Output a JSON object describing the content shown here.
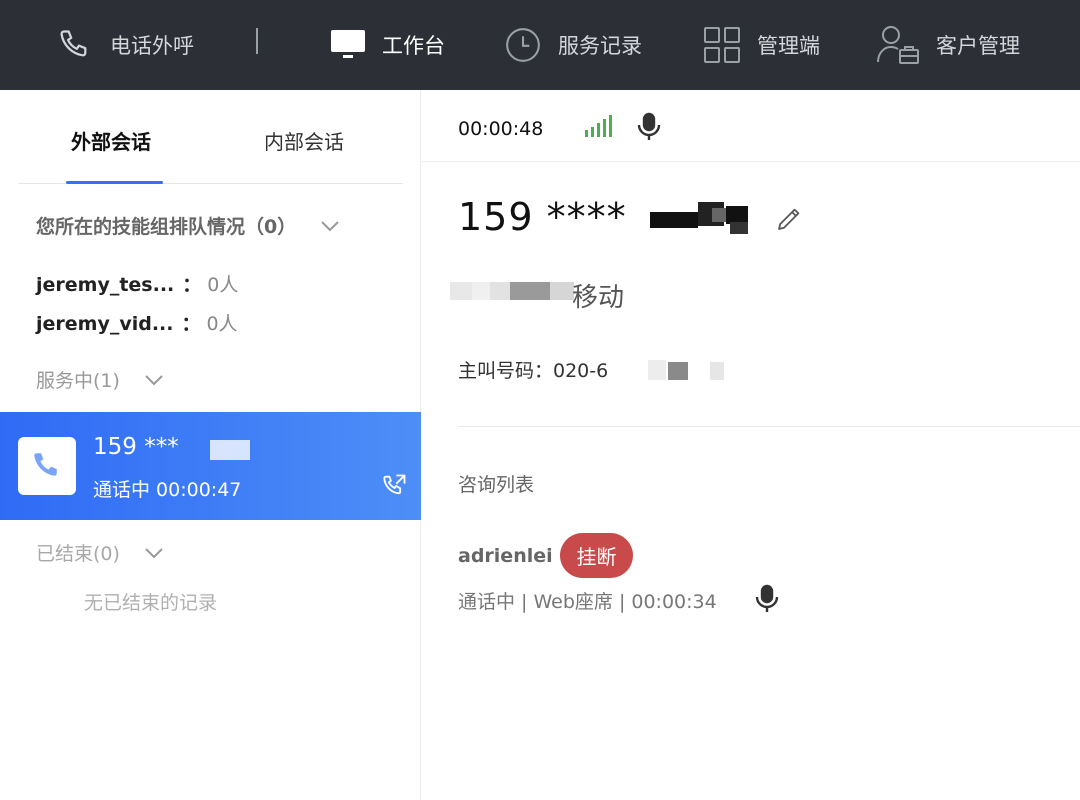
{
  "topnav": {
    "items": [
      {
        "label": "电话外呼",
        "icon": "phone-icon"
      },
      {
        "label": "工作台",
        "icon": "monitor-icon",
        "active": true
      },
      {
        "label": "服务记录",
        "icon": "clock-icon"
      },
      {
        "label": "管理端",
        "icon": "grid-icon"
      },
      {
        "label": "客户管理",
        "icon": "user-briefcase-icon"
      }
    ]
  },
  "left": {
    "tabs": [
      {
        "label": "外部会话",
        "active": true
      },
      {
        "label": "内部会话"
      }
    ],
    "queue": {
      "title": "您所在的技能组排队情况（0）",
      "rows": [
        {
          "name": "jeremy_tes...",
          "colon": "：",
          "count": "0人"
        },
        {
          "name": "jeremy_vid...",
          "colon": "：",
          "count": "0人"
        }
      ]
    },
    "serving": {
      "title": "服务中(1)",
      "card": {
        "number": "159 ***",
        "status": "通话中 00:00:47"
      }
    },
    "ended": {
      "title": "已结束(0)",
      "empty": "无已结束的记录"
    }
  },
  "right": {
    "timer": "00:00:48",
    "caller_number": "159 ****",
    "location": "移动",
    "main_number": "主叫号码：020-6",
    "consult_title": "咨询列表",
    "consult": {
      "name": "adrienlei",
      "hangup_label": "挂断",
      "meta": "通话中 | Web座席 | 00:00:34"
    }
  },
  "colors": {
    "nav_bg": "#2c2f36",
    "accent": "#3370ff",
    "card_gradient_start": "#2f6bf5",
    "card_gradient_end": "#4d8ef7",
    "signal": "#4caf50",
    "hangup": "#c94a4a"
  }
}
